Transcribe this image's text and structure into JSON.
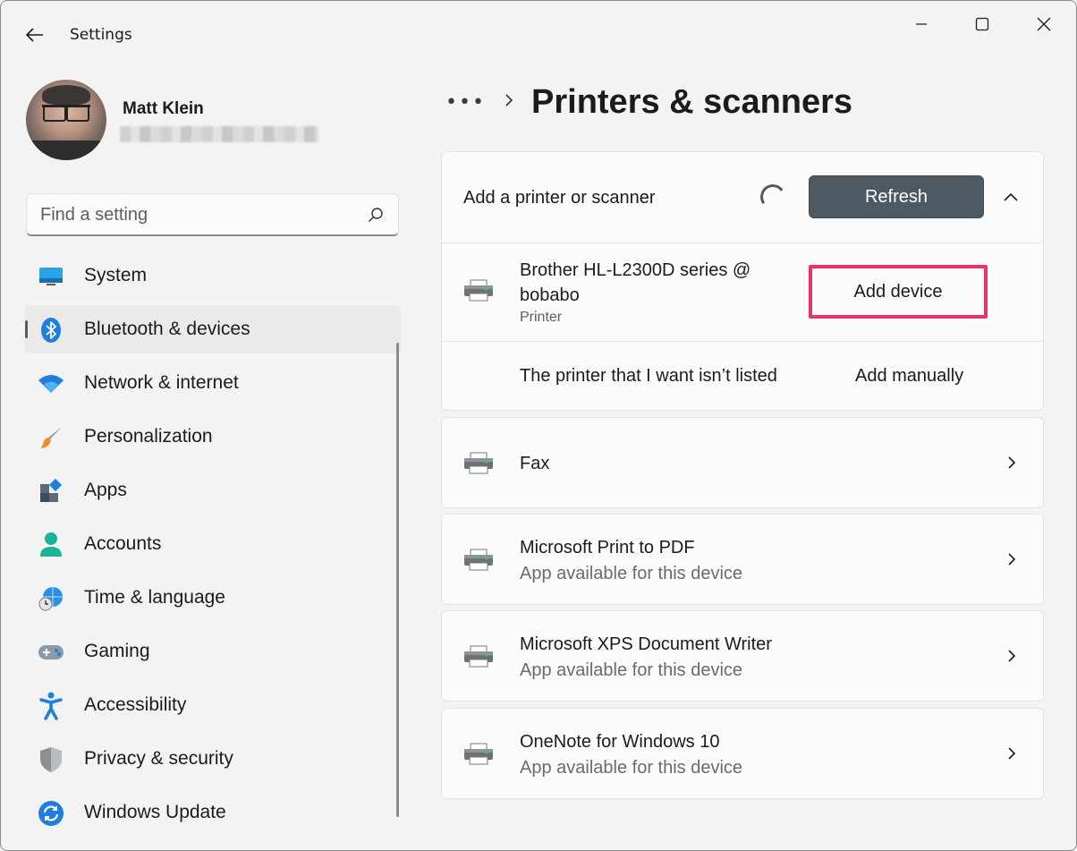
{
  "titlebar": {
    "app_title": "Settings",
    "back_icon": "arrow-left-icon",
    "minimize_icon": "minimize-icon",
    "maximize_icon": "maximize-icon",
    "close_icon": "close-icon"
  },
  "profile": {
    "name": "Matt Klein",
    "email": ""
  },
  "search": {
    "placeholder": "Find a setting",
    "value": "",
    "icon": "search-icon"
  },
  "sidebar": {
    "items": [
      {
        "label": "System",
        "icon": "system-monitor-icon",
        "active": false
      },
      {
        "label": "Bluetooth & devices",
        "icon": "bluetooth-icon",
        "active": true
      },
      {
        "label": "Network & internet",
        "icon": "wifi-icon",
        "active": false
      },
      {
        "label": "Personalization",
        "icon": "paintbrush-icon",
        "active": false
      },
      {
        "label": "Apps",
        "icon": "apps-icon",
        "active": false
      },
      {
        "label": "Accounts",
        "icon": "person-icon",
        "active": false
      },
      {
        "label": "Time & language",
        "icon": "globe-clock-icon",
        "active": false
      },
      {
        "label": "Gaming",
        "icon": "gamepad-icon",
        "active": false
      },
      {
        "label": "Accessibility",
        "icon": "accessibility-icon",
        "active": false
      },
      {
        "label": "Privacy & security",
        "icon": "shield-icon",
        "active": false
      },
      {
        "label": "Windows Update",
        "icon": "sync-icon",
        "active": false
      }
    ]
  },
  "breadcrumb": {
    "more": "•••",
    "title": "Printers & scanners"
  },
  "add_section": {
    "label": "Add a printer or scanner",
    "refresh_label": "Refresh",
    "device": {
      "name": "Brother HL-L2300D series @ bobabo",
      "type": "Printer",
      "button_label": "Add device"
    },
    "manual": {
      "text": "The printer that I want isn’t listed",
      "button_label": "Add manually"
    }
  },
  "printers": [
    {
      "name": "Fax",
      "subtitle": ""
    },
    {
      "name": "Microsoft Print to PDF",
      "subtitle": "App available for this device"
    },
    {
      "name": "Microsoft XPS Document Writer",
      "subtitle": "App available for this device"
    },
    {
      "name": "OneNote for Windows 10",
      "subtitle": "App available for this device"
    }
  ],
  "colors": {
    "accent_button": "#4d5a63",
    "highlight_border": "#e8336f",
    "background": "#f3f3f3",
    "card": "#fbfbfb"
  }
}
